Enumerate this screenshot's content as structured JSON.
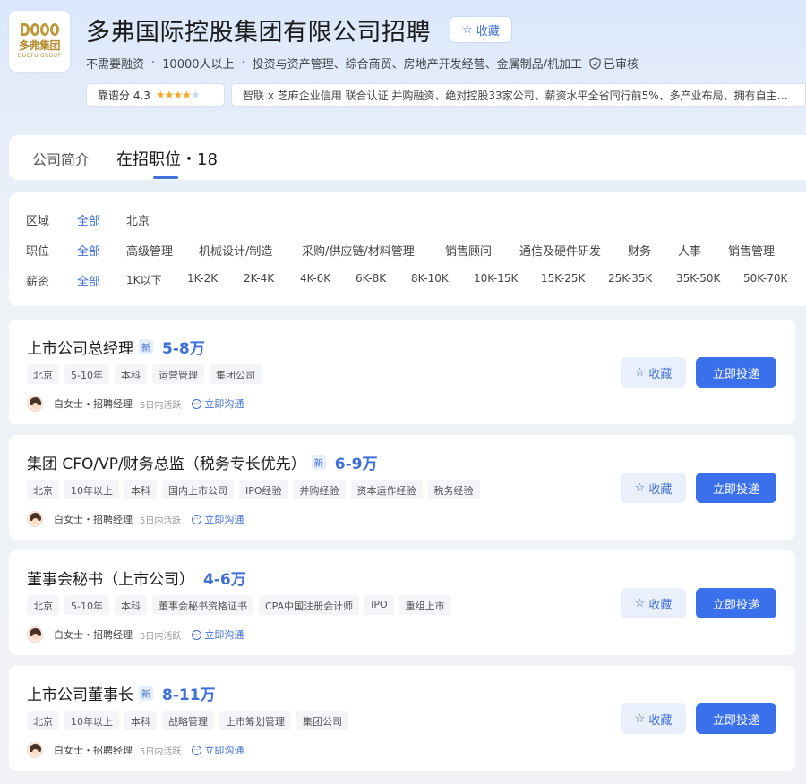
{
  "company": {
    "logo_cn": "多弗集团",
    "logo_en": "DUOFU GROUP",
    "name": "多弗国际控股集团有限公司招聘",
    "fav_label": "收藏",
    "funding": "不需要融资",
    "size": "10000人以上",
    "industry": "投资与资产管理、综合商贸、房地产开发经营、金属制品/机加工",
    "verified": "已审核",
    "score_label": "靠谱分 4.3",
    "score": 4.3,
    "highlights": "智联 x 芝麻企业信用 联合认证  并购融资、绝对控股33家公司、薪资水平全省同行前5%、多产业布局、拥有自主…"
  },
  "tabs": [
    {
      "label": "公司简介"
    },
    {
      "label": "在招职位・18"
    }
  ],
  "filters": {
    "region": {
      "label": "区域",
      "options": [
        "全部",
        "北京"
      ]
    },
    "position": {
      "label": "职位",
      "options": [
        "全部",
        "高级管理",
        "机械设计/制造",
        "采购/供应链/材料管理",
        "销售顾问",
        "通信及硬件研发",
        "财务",
        "人事",
        "销售管理"
      ]
    },
    "salary": {
      "label": "薪资",
      "options": [
        "全部",
        "1K以下",
        "1K-2K",
        "2K-4K",
        "4K-6K",
        "6K-8K",
        "8K-10K",
        "10K-15K",
        "15K-25K",
        "25K-35K",
        "35K-50K",
        "50K-70K"
      ]
    }
  },
  "jobs": [
    {
      "title": "上市公司总经理",
      "new": "新",
      "salary": "5-8万",
      "tags": [
        "北京",
        "5-10年",
        "本科",
        "运营管理",
        "集团公司"
      ],
      "recruiter": "白女士・招聘经理",
      "active": "5日内活跃",
      "chat": "立即沟通",
      "fav": "收藏",
      "apply": "立即投递"
    },
    {
      "title": "集团 CFO/VP/财务总监（税务专长优先）",
      "new": "新",
      "salary": "6-9万",
      "tags": [
        "北京",
        "10年以上",
        "本科",
        "国内上市公司",
        "IPO经验",
        "并购经验",
        "资本运作经验",
        "税务经验"
      ],
      "recruiter": "白女士・招聘经理",
      "active": "5日内活跃",
      "chat": "立即沟通",
      "fav": "收藏",
      "apply": "立即投递"
    },
    {
      "title": "董事会秘书（上市公司）",
      "new": "",
      "salary": "4-6万",
      "tags": [
        "北京",
        "5-10年",
        "本科",
        "董事会秘书资格证书",
        "CPA中国注册会计师",
        "IPO",
        "重组上市"
      ],
      "recruiter": "白女士・招聘经理",
      "active": "5日内活跃",
      "chat": "立即沟通",
      "fav": "收藏",
      "apply": "立即投递"
    },
    {
      "title": "上市公司董事长",
      "new": "新",
      "salary": "8-11万",
      "tags": [
        "北京",
        "10年以上",
        "本科",
        "战略管理",
        "上市筹划管理",
        "集团公司"
      ],
      "recruiter": "白女士・招聘经理",
      "active": "5日内活跃",
      "chat": "立即沟通",
      "fav": "收藏",
      "apply": "立即投递"
    }
  ]
}
